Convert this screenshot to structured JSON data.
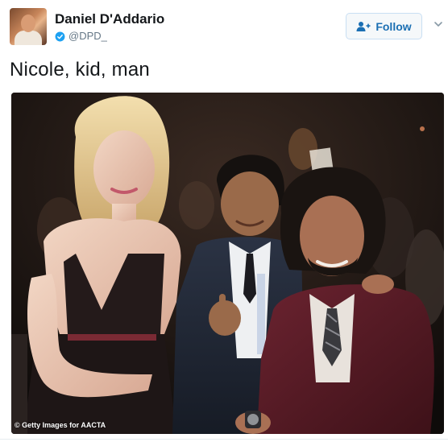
{
  "author": {
    "display_name": "Daniel D'Addario",
    "handle": "@DPD_",
    "verified_icon": "verified-badge-icon",
    "avatar_icon": "user-avatar"
  },
  "follow": {
    "label": "Follow",
    "icon": "follow-user-icon"
  },
  "menu": {
    "icon": "chevron-down-icon"
  },
  "tweet": {
    "text": "Nicole, kid, man"
  },
  "media": {
    "credit": "© Getty Images for AACTA"
  },
  "colors": {
    "accent": "#1da1f2",
    "follow_text": "#1b6fb3",
    "text": "#14171a",
    "secondary": "#657786"
  }
}
